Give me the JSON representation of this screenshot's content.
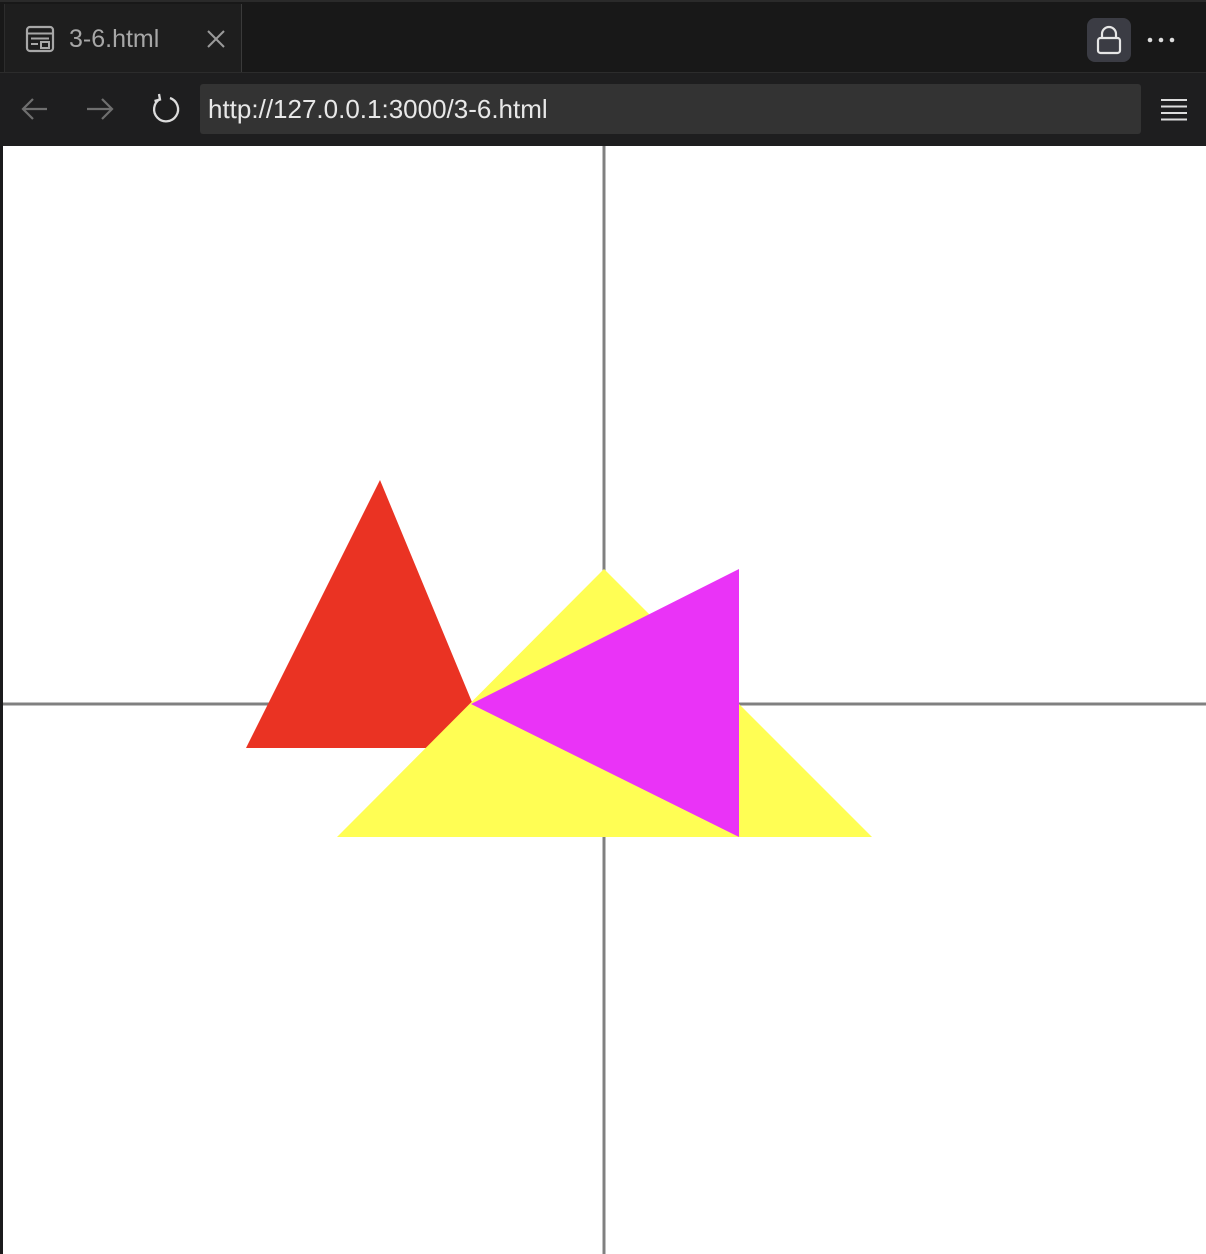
{
  "tab": {
    "title": "3-6.html",
    "icon": "page-icon"
  },
  "toolbar": {
    "url": "http://127.0.0.1:3000/3-6.html"
  },
  "canvas": {
    "background": "#ffffff",
    "axis_color": "#808080",
    "triangles": [
      {
        "name": "red-triangle",
        "color": "#ea3323"
      },
      {
        "name": "yellow-triangle",
        "color": "#fffe54"
      },
      {
        "name": "magenta-triangle",
        "color": "#ea33f7"
      }
    ]
  }
}
